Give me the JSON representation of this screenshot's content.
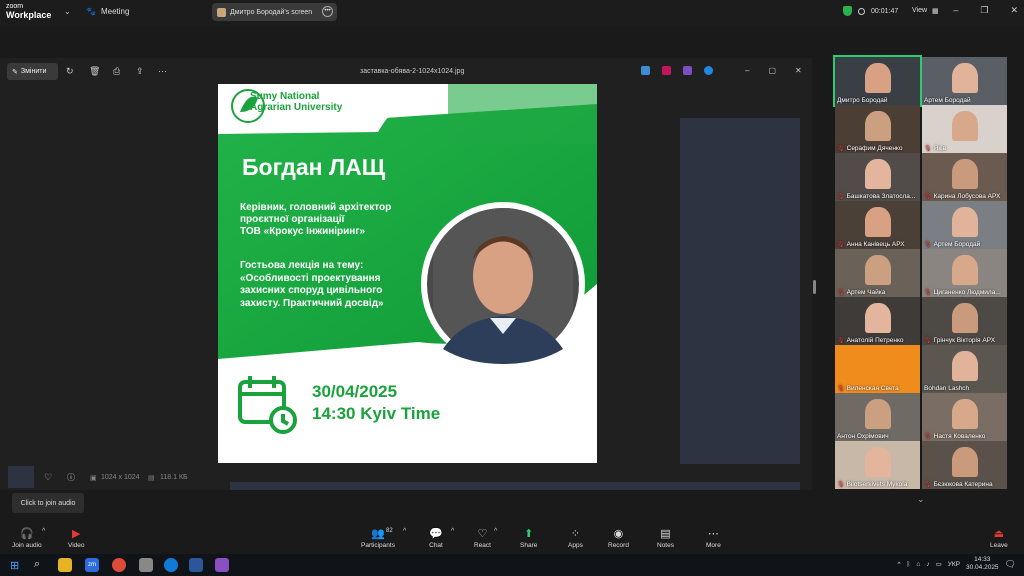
{
  "app": {
    "brand_line1": "zoom",
    "brand_line2": "Workplace",
    "meeting_label": "Meeting",
    "screen_label": "Дмитро Бородай's screen",
    "timer": "00:01:47",
    "view_label": "View"
  },
  "viewer": {
    "edit_label": "Змінити",
    "filename": "заставка-обява-2-1024x1024.jpg",
    "dimensions": "1024 x 1024",
    "filesize": "118.1 КБ"
  },
  "poster": {
    "university_line1": "Sumy National",
    "university_line2": "Agrarian University",
    "speaker": "Богдан ЛАЩ",
    "role_line1": "Керівник, головний архітектор",
    "role_line2": "проєктної організації",
    "role_line3": "ТОВ «Крокус Інжиніринг»",
    "topic_line1": "Гостьова лекція на тему:",
    "topic_line2": "«Особливості проектування",
    "topic_line3": "захисних споруд цивільного",
    "topic_line4": "захисту. Практичний досвід»",
    "date": "30/04/2025",
    "time": "14:30 Kyiv Time",
    "brand_green": "#1aa33c"
  },
  "participants": [
    {
      "name": "Дмитро Бородай",
      "muted": false,
      "active": true
    },
    {
      "name": "Артем Бородай",
      "muted": false,
      "active": false
    },
    {
      "name": "Серафим Дяченко",
      "muted": true,
      "active": false
    },
    {
      "name": "Яків",
      "muted": true,
      "active": false
    },
    {
      "name": "Башкатова Златосла...",
      "muted": true,
      "active": false
    },
    {
      "name": "Карина Лобусова АРХ",
      "muted": true,
      "active": false
    },
    {
      "name": "Анна Канівець АРХ",
      "muted": true,
      "active": false
    },
    {
      "name": "Артем Бородай",
      "muted": true,
      "active": false
    },
    {
      "name": "Артем Чайка",
      "muted": true,
      "active": false
    },
    {
      "name": "Циганенко Людмила...",
      "muted": true,
      "active": false
    },
    {
      "name": "Анатолій Петренко",
      "muted": true,
      "active": false
    },
    {
      "name": "Грінчук Вікторія АРХ",
      "muted": true,
      "active": false
    },
    {
      "name": "Виленская Света",
      "muted": true,
      "active": false
    },
    {
      "name": "Bohdan Lashch",
      "muted": false,
      "active": false
    },
    {
      "name": "Антон Охрімович",
      "muted": false,
      "active": false
    },
    {
      "name": "Настя Коваленко",
      "muted": true,
      "active": false
    },
    {
      "name": "Bilotserkivets Mykola",
      "muted": true,
      "active": false
    },
    {
      "name": "Бєзюкова Катерина",
      "muted": true,
      "active": false
    }
  ],
  "tooltip": "Click to join audio",
  "toolbar": {
    "join_audio": "Join audio",
    "video": "Video",
    "participants": "Participants",
    "participants_count": "82",
    "chat": "Chat",
    "react": "React",
    "share": "Share",
    "apps": "Apps",
    "record": "Record",
    "notes": "Notes",
    "more": "More",
    "leave": "Leave"
  },
  "taskbar": {
    "lang": "УКР",
    "time": "14:33",
    "date": "30.04.2025"
  }
}
